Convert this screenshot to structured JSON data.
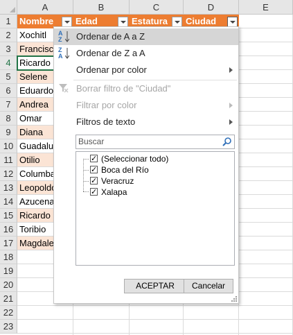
{
  "columns": [
    "A",
    "B",
    "C",
    "D",
    "E"
  ],
  "header_row": {
    "A": "Nombre",
    "B": "Edad",
    "C": "Estatura",
    "D": "Ciudad"
  },
  "rows": [
    "1",
    "2",
    "3",
    "4",
    "5",
    "6",
    "7",
    "8",
    "9",
    "10",
    "11",
    "12",
    "13",
    "14",
    "15",
    "16",
    "17",
    "18",
    "19",
    "20",
    "21",
    "22",
    "23"
  ],
  "names": [
    "Xochitl",
    "Francisco",
    "Ricardo",
    "Selene",
    "Eduardo",
    "Andrea",
    "Omar",
    "Diana",
    "Guadalupe",
    "Otilio",
    "Columba",
    "Leopoldo",
    "Azucena",
    "Ricardo",
    "Toribio",
    "Magdalena"
  ],
  "colors": {
    "header_bg": "#ed7d31",
    "band_bg": "#fbe4d5",
    "selection": "#217346"
  },
  "filter_menu": {
    "sort_az": "Ordenar de A a Z",
    "sort_za": "Ordenar de Z a A",
    "sort_by_color": "Ordenar por color",
    "clear_filter": "Borrar filtro de \"Ciudad\"",
    "filter_by_color": "Filtrar por color",
    "text_filters": "Filtros de texto",
    "search_placeholder": "Buscar",
    "items": [
      "(Seleccionar todo)",
      "Boca del Río",
      "Veracruz",
      "Xalapa"
    ],
    "ok": "ACEPTAR",
    "cancel": "Cancelar",
    "icons": [
      "sort-az-icon",
      "sort-za-icon",
      "clear-filter-icon",
      "search-icon"
    ]
  }
}
